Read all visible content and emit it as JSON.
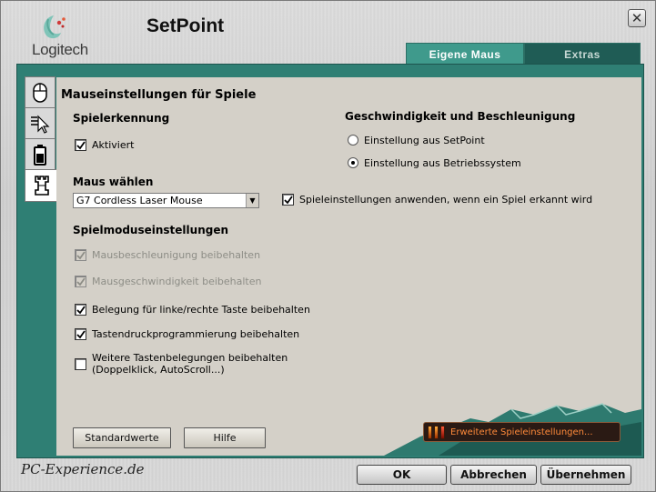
{
  "app": {
    "brand": "Logitech",
    "title": "SetPoint"
  },
  "tabs": [
    {
      "label": "Eigene Maus",
      "active": true
    },
    {
      "label": "Extras",
      "active": false
    }
  ],
  "side_tabs": [
    {
      "icon": "mouse-icon",
      "active": false
    },
    {
      "icon": "pointer-icon",
      "active": false
    },
    {
      "icon": "battery-icon",
      "active": false
    },
    {
      "icon": "chess-rook-icon",
      "active": true
    }
  ],
  "panel": {
    "title": "Mauseinstellungen für Spiele",
    "detection": {
      "heading": "Spielerkennung",
      "activated": {
        "label": "Aktiviert",
        "checked": true
      }
    },
    "speed": {
      "heading": "Geschwindigkeit und Beschleunigung",
      "options": [
        {
          "label": "Einstellung aus SetPoint",
          "selected": false
        },
        {
          "label": "Einstellung aus Betriebssystem",
          "selected": true
        }
      ]
    },
    "mouse_select": {
      "heading": "Maus wählen",
      "value": "G7 Cordless Laser Mouse"
    },
    "apply_game": {
      "label": "Spieleinstellungen anwenden, wenn ein Spiel erkannt wird",
      "checked": true
    },
    "game_mode": {
      "heading": "Spielmoduseinstellungen",
      "options": [
        {
          "label": "Mausbeschleunigung beibehalten",
          "checked": true,
          "disabled": true
        },
        {
          "label": "Mausgeschwindigkeit beibehalten",
          "checked": true,
          "disabled": true
        },
        {
          "label": "Belegung für linke/rechte Taste beibehalten",
          "checked": true,
          "disabled": false
        },
        {
          "label": "Tastendruckprogrammierung beibehalten",
          "checked": true,
          "disabled": false
        },
        {
          "label": "Weitere Tastenbelegungen beibehalten",
          "label2": "(Doppelklick, AutoScroll...)",
          "checked": false,
          "disabled": false
        }
      ]
    },
    "buttons": {
      "defaults": "Standardwerte",
      "help": "Hilfe"
    },
    "extended_button": "Erweiterte Spieleinstellungen..."
  },
  "footer": {
    "watermark": "PC-Experience.de",
    "ok": "OK",
    "cancel": "Abbrechen",
    "apply": "Übernehmen"
  },
  "colors": {
    "accent": "#2f7f74",
    "tab_active": "#3f9a8c",
    "tab_inactive": "#1f5c55",
    "panel": "#d4d0c8"
  }
}
